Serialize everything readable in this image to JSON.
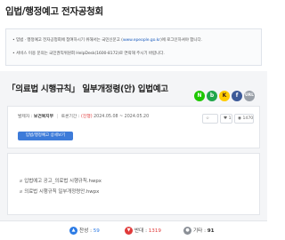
{
  "header": {
    "title": "입법/행정예고 전자공청회"
  },
  "notice": {
    "line1_prefix": "• 입법 · 행정예고 전자공청회에 참여하시기 위해서는 국민신문고 (",
    "line1_link": "www.epeople.go.kr",
    "line1_suffix": ")에 로그인하셔야 합니다.",
    "line2": "• 서비스 이용 문의는 국민권익위원회 HelpDesk(1600-8172)로 연락해 주시기 바랍니다."
  },
  "post": {
    "title": "「의료법 시행규칙」 일부개정령(안) 입법예고",
    "department_label": "발제자 :",
    "department": "보건복지부",
    "period_label": "토론기간 :",
    "status": "(진행)",
    "period": "2024.05.08 ~ 2024.05.20",
    "detail_button": "입법/행정예고 상세보기",
    "stats": {
      "likes": "1",
      "views": "1470"
    }
  },
  "share": {
    "naver": "N",
    "band": "b",
    "kakao": "K",
    "facebook": "f",
    "url": "URL"
  },
  "attachments": [
    "입법예고 공고_의료법 시행규칙.hwpx",
    "의료법 시행규칙 일부개정령안.hwpx"
  ],
  "votes": {
    "agree_label": "찬성 :",
    "agree_count": "59",
    "oppose_label": "반대 :",
    "oppose_count": "1319",
    "other_label": "기타 :",
    "other_count": "91"
  }
}
